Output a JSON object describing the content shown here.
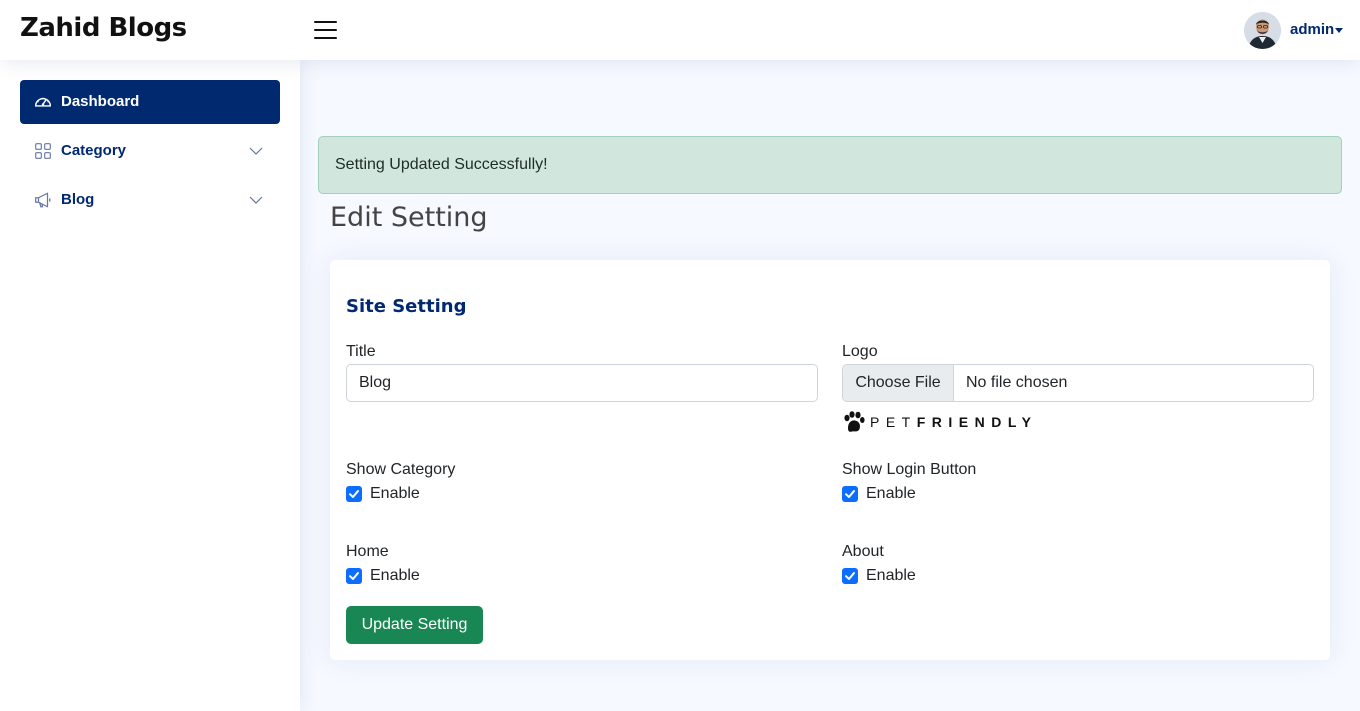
{
  "header": {
    "brand": "Zahid Blogs",
    "user_name": "admin"
  },
  "sidebar": {
    "items": [
      {
        "label": "Dashboard",
        "icon": "speedometer-icon",
        "active": true
      },
      {
        "label": "Category",
        "icon": "grid-icon",
        "expandable": true
      },
      {
        "label": "Blog",
        "icon": "megaphone-icon",
        "expandable": true
      }
    ]
  },
  "alert": {
    "message": "Setting Updated Successfully!"
  },
  "page": {
    "title": "Edit Setting"
  },
  "card": {
    "title": "Site Setting",
    "fields": {
      "title_label": "Title",
      "title_value": "Blog",
      "logo_label": "Logo",
      "file_button": "Choose File",
      "file_status": "No file chosen",
      "logo_brand_light": "PET",
      "logo_brand_bold": "FRIENDLY",
      "show_category_label": "Show Category",
      "show_category_check": "Enable",
      "show_login_label": "Show Login Button",
      "show_login_check": "Enable",
      "home_label": "Home",
      "home_check": "Enable",
      "about_label": "About",
      "about_check": "Enable"
    },
    "submit_label": "Update Setting"
  },
  "colors": {
    "primary": "#012970",
    "checkbox": "#0d6efd",
    "success": "#198754",
    "alert_bg": "#d1e7dd"
  }
}
